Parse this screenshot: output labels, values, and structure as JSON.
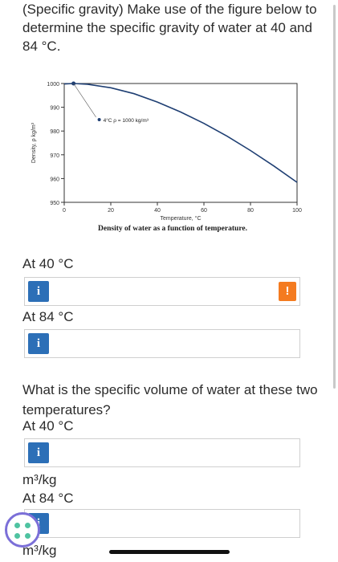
{
  "question": {
    "part1": "(Specific gravity) Make use of the figure below to determine the specific gravity of water at 40 and 84 °C.",
    "part2": "What is the specific volume of water at these two temperatures?"
  },
  "caption": "Density of water as a function of temperature.",
  "fields": {
    "sg40": {
      "label": "At 40 °C",
      "info": "i",
      "value": "",
      "warning": "!"
    },
    "sg84": {
      "label": "At 84 °C",
      "info": "i",
      "value": ""
    },
    "sv40": {
      "label": "At 40 °C",
      "info": "i",
      "value": "",
      "unit": "m³/kg"
    },
    "sv84": {
      "label": "At 84 °C",
      "info": "i",
      "value": "",
      "unit": "m³/kg"
    }
  },
  "chart_data": {
    "type": "line",
    "xlabel": "Temperature, °C",
    "ylabel": "Density, ρ kg/m³",
    "xlim": [
      0,
      100
    ],
    "ylim": [
      950,
      1000
    ],
    "xticks": [
      "0",
      "20",
      "40",
      "60",
      "80",
      "100"
    ],
    "yticks": [
      "1000",
      "990",
      "980",
      "970",
      "960",
      "950"
    ],
    "annotation": "4°C ρ = 1000 kg/m³",
    "annotation_point": {
      "x": 4,
      "y": 1000
    },
    "series": [
      {
        "color": "#1f3f73",
        "x": [
          0,
          4,
          10,
          20,
          30,
          40,
          50,
          60,
          70,
          80,
          90,
          100
        ],
        "y": [
          999.8,
          1000.0,
          999.7,
          998.2,
          995.7,
          992.2,
          988.0,
          983.2,
          977.8,
          971.8,
          965.3,
          958.4
        ]
      }
    ]
  }
}
